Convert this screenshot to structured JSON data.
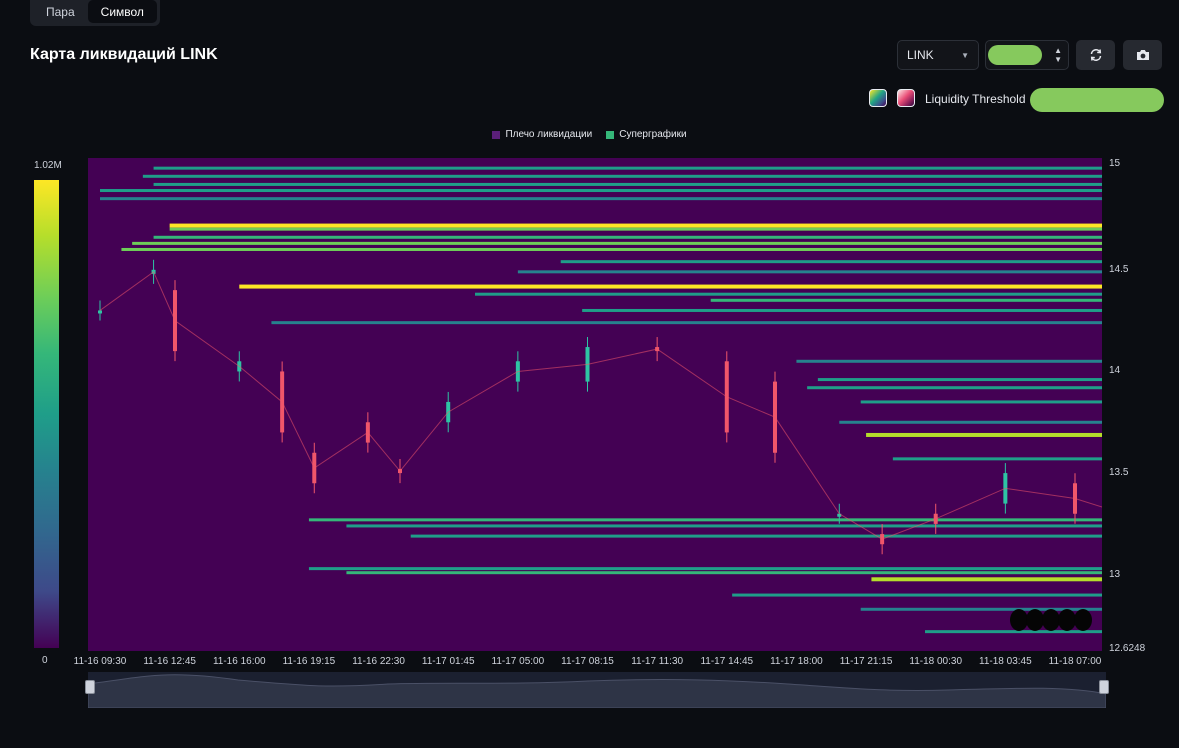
{
  "tabs": [
    {
      "label": "Пара",
      "active": false
    },
    {
      "label": "Символ",
      "active": true
    }
  ],
  "title": "Карта ликвидаций LINK",
  "controls": {
    "symbol": "LINK",
    "refresh_icon": "refresh-icon",
    "camera_icon": "camera-icon"
  },
  "threshold": {
    "label": "Liquidity Threshold"
  },
  "legend": [
    {
      "label": "Плечо ликвидации",
      "color": "#440154"
    },
    {
      "label": "Суперграфики",
      "color": "#35b779"
    }
  ],
  "colorbar": {
    "max_label": "1.02M",
    "min_label": "0",
    "colors": [
      "#440154",
      "#3e4989",
      "#31688e",
      "#26828e",
      "#1f9e89",
      "#35b779",
      "#6ece58",
      "#b5de2b",
      "#fde725"
    ]
  },
  "chart_data": {
    "type": "heatmap",
    "title": "Карта ликвидаций LINK",
    "y_ticks": [
      "15",
      "14.5",
      "14",
      "13.5",
      "13",
      "12.6248"
    ],
    "ylim": [
      12.6248,
      15.05
    ],
    "x_ticks": [
      "11-16 09:30",
      "11-16 12:45",
      "11-16 16:00",
      "11-16 19:15",
      "11-16 22:30",
      "11-17 01:45",
      "11-17 05:00",
      "11-17 08:15",
      "11-17 11:30",
      "11-17 14:45",
      "11-17 18:00",
      "11-17 21:15",
      "11-18 00:30",
      "11-18 03:45",
      "11-18 07:00"
    ],
    "liquidation_levels": [
      {
        "price": 15.0,
        "start": "11-16 12:00",
        "intensity": 0.5
      },
      {
        "price": 14.96,
        "start": "11-16 11:30",
        "intensity": 0.55
      },
      {
        "price": 14.92,
        "start": "11-16 12:00",
        "intensity": 0.5
      },
      {
        "price": 14.89,
        "start": "11-16 09:30",
        "intensity": 0.45
      },
      {
        "price": 14.85,
        "start": "11-16 09:30",
        "intensity": 0.4
      },
      {
        "price": 14.72,
        "start": "11-16 12:45",
        "intensity": 0.95
      },
      {
        "price": 14.7,
        "start": "11-16 12:45",
        "intensity": 0.7
      },
      {
        "price": 14.66,
        "start": "11-16 12:00",
        "intensity": 0.6
      },
      {
        "price": 14.63,
        "start": "11-16 11:00",
        "intensity": 0.7
      },
      {
        "price": 14.6,
        "start": "11-16 10:30",
        "intensity": 0.8
      },
      {
        "price": 14.54,
        "start": "11-17 07:00",
        "intensity": 0.45
      },
      {
        "price": 14.49,
        "start": "11-17 05:00",
        "intensity": 0.4
      },
      {
        "price": 14.42,
        "start": "11-16 16:00",
        "intensity": 0.95
      },
      {
        "price": 14.38,
        "start": "11-17 03:00",
        "intensity": 0.45
      },
      {
        "price": 14.35,
        "start": "11-17 14:00",
        "intensity": 0.6
      },
      {
        "price": 14.3,
        "start": "11-17 08:00",
        "intensity": 0.5
      },
      {
        "price": 14.24,
        "start": "11-16 17:30",
        "intensity": 0.4
      },
      {
        "price": 14.05,
        "start": "11-17 18:00",
        "intensity": 0.4
      },
      {
        "price": 13.96,
        "start": "11-17 19:00",
        "intensity": 0.5
      },
      {
        "price": 13.92,
        "start": "11-17 18:30",
        "intensity": 0.45
      },
      {
        "price": 13.85,
        "start": "11-17 21:00",
        "intensity": 0.5
      },
      {
        "price": 13.75,
        "start": "11-17 20:00",
        "intensity": 0.4
      },
      {
        "price": 13.69,
        "start": "11-17 21:15",
        "intensity": 0.9
      },
      {
        "price": 13.57,
        "start": "11-17 22:30",
        "intensity": 0.45
      },
      {
        "price": 13.27,
        "start": "11-16 19:15",
        "intensity": 0.6
      },
      {
        "price": 13.24,
        "start": "11-16 21:00",
        "intensity": 0.55
      },
      {
        "price": 13.19,
        "start": "11-17 00:00",
        "intensity": 0.5
      },
      {
        "price": 13.03,
        "start": "11-16 19:15",
        "intensity": 0.55
      },
      {
        "price": 13.01,
        "start": "11-16 21:00",
        "intensity": 0.6
      },
      {
        "price": 12.98,
        "start": "11-17 21:30",
        "intensity": 0.9
      },
      {
        "price": 12.9,
        "start": "11-17 15:00",
        "intensity": 0.45
      },
      {
        "price": 12.83,
        "start": "11-17 21:00",
        "intensity": 0.4
      },
      {
        "price": 12.72,
        "start": "11-18 00:00",
        "intensity": 0.45
      }
    ],
    "candles": [
      {
        "time": "11-16 09:30",
        "open": 14.3,
        "close": 14.3
      },
      {
        "time": "11-16 12:00",
        "open": 14.48,
        "close": 14.5
      },
      {
        "time": "11-16 13:00",
        "open": 14.4,
        "close": 14.1
      },
      {
        "time": "11-16 16:00",
        "open": 14.0,
        "close": 14.05
      },
      {
        "time": "11-16 18:00",
        "open": 14.0,
        "close": 13.7
      },
      {
        "time": "11-16 19:30",
        "open": 13.6,
        "close": 13.45
      },
      {
        "time": "11-16 22:00",
        "open": 13.75,
        "close": 13.65
      },
      {
        "time": "11-16 23:30",
        "open": 13.52,
        "close": 13.5
      },
      {
        "time": "11-17 01:45",
        "open": 13.75,
        "close": 13.85
      },
      {
        "time": "11-17 05:00",
        "open": 13.95,
        "close": 14.05
      },
      {
        "time": "11-17 08:15",
        "open": 13.95,
        "close": 14.12
      },
      {
        "time": "11-17 11:30",
        "open": 14.12,
        "close": 14.1
      },
      {
        "time": "11-17 14:45",
        "open": 14.05,
        "close": 13.7
      },
      {
        "time": "11-17 17:00",
        "open": 13.95,
        "close": 13.6
      },
      {
        "time": "11-17 20:00",
        "open": 13.3,
        "close": 13.3
      },
      {
        "time": "11-17 22:00",
        "open": 13.2,
        "close": 13.15
      },
      {
        "time": "11-18 00:30",
        "open": 13.3,
        "close": 13.25
      },
      {
        "time": "11-18 03:45",
        "open": 13.35,
        "close": 13.5
      },
      {
        "time": "11-18 07:00",
        "open": 13.45,
        "close": 13.3
      },
      {
        "time": "11-18 08:30",
        "open": 13.3,
        "close": 13.35
      }
    ],
    "candle_colors": {
      "up": "#2ec4a4",
      "down": "#f0566a"
    }
  }
}
